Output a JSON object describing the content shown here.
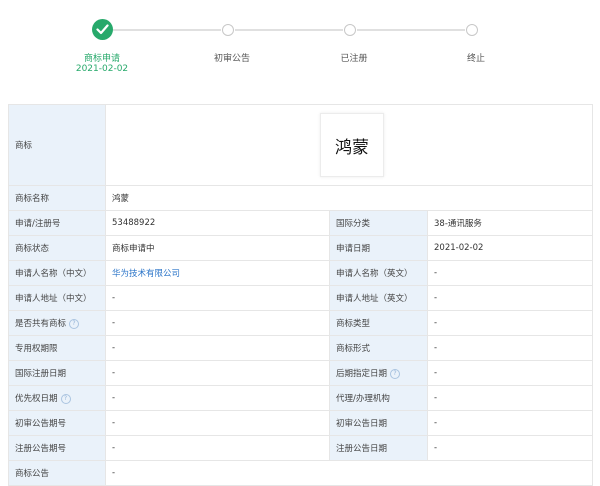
{
  "progress": {
    "steps": [
      {
        "label": "商标申请",
        "date": "2021-02-02"
      },
      {
        "label": "初审公告"
      },
      {
        "label": "已注册"
      },
      {
        "label": "终止"
      }
    ],
    "accent_color": "#27a96b"
  },
  "trademark": {
    "label": "商标",
    "image_text": "鸿蒙"
  },
  "details": {
    "name": {
      "label": "商标名称",
      "value": "鸿蒙"
    },
    "reg_no": {
      "label": "申请/注册号",
      "value": "53488922"
    },
    "intl_class": {
      "label": "国际分类",
      "value": "38-通讯服务"
    },
    "status": {
      "label": "商标状态",
      "value": "商标申请中"
    },
    "apply_date": {
      "label": "申请日期",
      "value": "2021-02-02"
    },
    "applicant_cn": {
      "label": "申请人名称（中文）",
      "value": "华为技术有限公司"
    },
    "applicant_en": {
      "label": "申请人名称（英文）",
      "value": "-"
    },
    "address_cn": {
      "label": "申请人地址（中文）",
      "value": "-"
    },
    "address_en": {
      "label": "申请人地址（英文）",
      "value": "-"
    },
    "shared": {
      "label": "是否共有商标",
      "value": "-"
    },
    "tm_type": {
      "label": "商标类型",
      "value": "-"
    },
    "exclusive_period": {
      "label": "专用权期限",
      "value": "-"
    },
    "tm_form": {
      "label": "商标形式",
      "value": "-"
    },
    "intl_reg_date": {
      "label": "国际注册日期",
      "value": "-"
    },
    "later_designation_date": {
      "label": "后期指定日期",
      "value": "-"
    },
    "priority_date": {
      "label": "优先权日期",
      "value": "-"
    },
    "agency": {
      "label": "代理/办理机构",
      "value": "-"
    },
    "prelim_issue": {
      "label": "初审公告期号",
      "value": "-"
    },
    "prelim_date": {
      "label": "初审公告日期",
      "value": "-"
    },
    "reg_issue": {
      "label": "注册公告期号",
      "value": "-"
    },
    "reg_date": {
      "label": "注册公告日期",
      "value": "-"
    },
    "announcement": {
      "label": "商标公告",
      "value": "-"
    }
  },
  "icons": {
    "step_done": "check-icon",
    "help": "question-circle-icon"
  }
}
